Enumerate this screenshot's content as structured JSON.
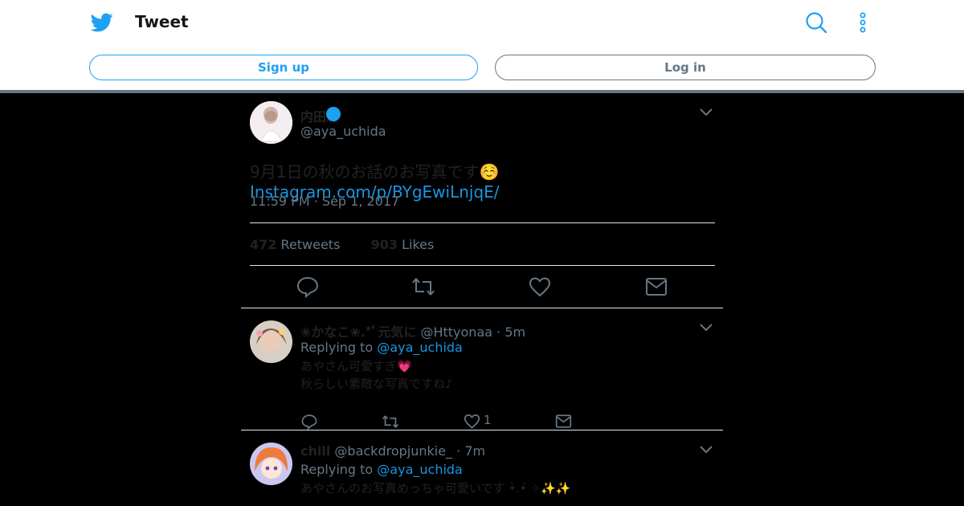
{
  "header": {
    "title": "Tweet",
    "signup_label": "Sign up",
    "login_label": "Log in"
  },
  "tweet": {
    "display_name": "内田彩",
    "handle": "@aya_uchida",
    "text": "9月1日の秋のお話のお写真です☺️ ",
    "link": "Instagram.com/p/BYgEwiLnjqE/",
    "timestamp": "11:59 PM · Sep 1, 2017",
    "retweets_count": "472",
    "retweets_label": "Retweets",
    "likes_count": "903",
    "likes_label": "Likes"
  },
  "replies": [
    {
      "display_name": "❀かなこ❀.*ﾟ元気に",
      "handle": "@Httyonaa",
      "time": "· 5m",
      "replying_label": "Replying to",
      "replying_to": "@aya_uchida",
      "line1": "あやさん可愛すぎ💗",
      "line2": "秋らしい素敵な写真ですね♪",
      "like_count": "1"
    },
    {
      "display_name": "chill",
      "handle": "@backdropjunkie_",
      "time": "· 7m",
      "replying_label": "Replying to",
      "replying_to": "@aya_uchida",
      "line1": "あやさんのお写真めっちゃ可愛いです •̀.•́ ✧✨✨",
      "line2": ""
    }
  ],
  "colors": {
    "accent": "#1da1f2",
    "link": "#1b95e0",
    "muted": "#657786",
    "background": "#000000"
  }
}
